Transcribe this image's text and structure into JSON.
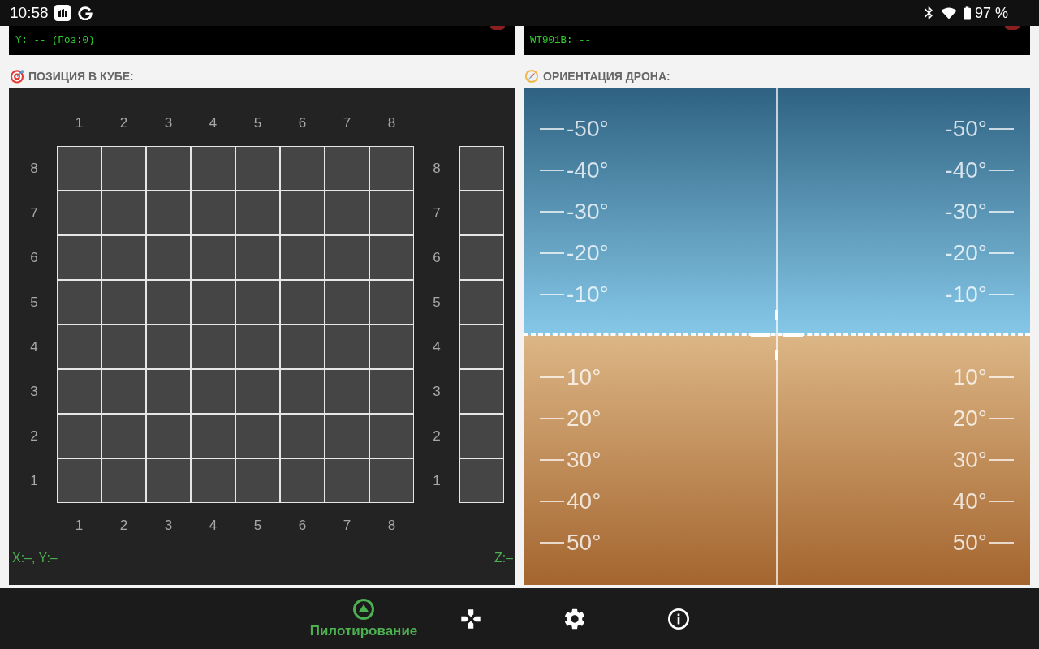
{
  "status_bar": {
    "time": "10:58",
    "battery": "97 %"
  },
  "sensor_panels": [
    {
      "text": "Y: -- (Поз:0)"
    },
    {
      "text": "WT901B: --"
    }
  ],
  "cube_position": {
    "title": "ПОЗИЦИЯ В КУБЕ:",
    "top_labels": [
      "1",
      "2",
      "3",
      "4",
      "5",
      "6",
      "7",
      "8"
    ],
    "left_labels": [
      "8",
      "7",
      "6",
      "5",
      "4",
      "3",
      "2",
      "1"
    ],
    "right_labels": [
      "8",
      "7",
      "6",
      "5",
      "4",
      "3",
      "2",
      "1"
    ],
    "bottom_labels": [
      "1",
      "2",
      "3",
      "4",
      "5",
      "6",
      "7",
      "8"
    ],
    "xy_readout": "X:–, Y:–",
    "z_readout": "Z:–"
  },
  "orientation": {
    "title": "ОРИЕНТАЦИЯ ДРОНА:",
    "sky_rungs": [
      {
        "left": "-50°",
        "right": "-50°"
      },
      {
        "left": "-40°",
        "right": "-40°"
      },
      {
        "left": "-30°",
        "right": "-30°"
      },
      {
        "left": "-20°",
        "right": "-20°"
      },
      {
        "left": "-10°",
        "right": "-10°"
      }
    ],
    "ground_rungs": [
      {
        "left": "10°",
        "right": "10°"
      },
      {
        "left": "20°",
        "right": "20°"
      },
      {
        "left": "30°",
        "right": "30°"
      },
      {
        "left": "40°",
        "right": "40°"
      },
      {
        "left": "50°",
        "right": "50°"
      }
    ]
  },
  "nav": [
    {
      "label": "Пилотирование",
      "selected": true
    },
    {
      "selected": false
    },
    {
      "selected": false
    },
    {
      "selected": false
    }
  ]
}
